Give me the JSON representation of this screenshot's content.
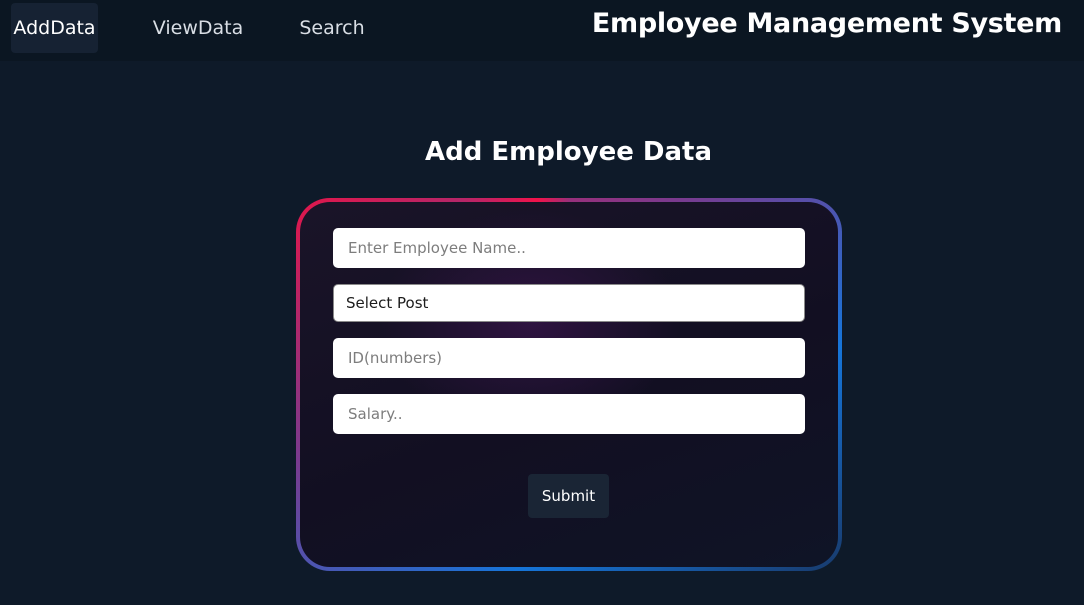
{
  "nav": {
    "items": [
      {
        "label": "AddData"
      },
      {
        "label": "ViewData"
      },
      {
        "label": "Search"
      }
    ],
    "brand": "Employee Management System"
  },
  "form": {
    "title": "Add Employee Data",
    "name_placeholder": "Enter Employee Name..",
    "post_selected": "Select Post",
    "id_placeholder": "ID(numbers)",
    "salary_placeholder": "Salary..",
    "submit_label": "Submit"
  },
  "colors": {
    "page_background": "#0e1a29",
    "navbar_background": "#0b1622",
    "active_nav_background": "#162233",
    "button_background": "#1a2535",
    "border_gradient_start": "#e3164a",
    "border_gradient_mid": "#7a3a8e",
    "border_gradient_end": "#1675d9"
  }
}
